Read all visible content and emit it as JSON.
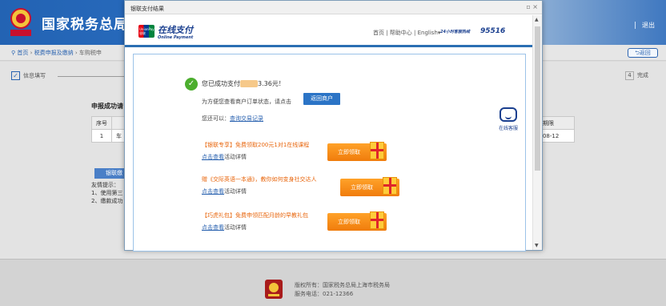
{
  "header": {
    "title": "国家税务总局上",
    "logout": "退出"
  },
  "nav": {
    "home": "首页",
    "crumb2": "税费申报及缴纳",
    "crumb3": "车购税申",
    "back": "返回"
  },
  "steps": {
    "first": "信息填写",
    "last_num": "4",
    "last": "完成"
  },
  "page": {
    "subtitle": "申报成功请",
    "table_left": {
      "headers": [
        "序号",
        ""
      ],
      "row": [
        "1",
        "车"
      ]
    },
    "table_right": {
      "header": "款期限",
      "value": "9-08-12"
    },
    "pay_button": "银联缴",
    "tips": [
      "友情提示：",
      "1、使用第三",
      "2、缴款成功"
    ]
  },
  "footer": {
    "copyright": "版权所有：国家税务总局上海市税务局",
    "phone": "服务电话：021-12366"
  },
  "modal": {
    "title": "银联支付结果",
    "controls": "▫ ×",
    "brand_cn": "在线支付",
    "brand_en": "Online Payment",
    "logo_text": "UnionPay 银联",
    "links": "首页 | 帮助中心 | English▾",
    "hotline_label": "24小时客服热线",
    "hotline": "95516",
    "success_prefix": "您已成功支付",
    "success_amount": "3.36元！",
    "hint": "为方便您查看商户订单状态，请点击",
    "return_button": "返回商户",
    "also": "您还可以：",
    "query_link": "查询交易记录",
    "service": "在线客服",
    "promos": [
      {
        "title": "【银联专享】免费领取200元1对1在线课程",
        "link": "点击查看",
        "rest": "活动详情",
        "button": "立即领取"
      },
      {
        "title": "赠《交际英语一本通》，教你如何变身社交达人",
        "link": "点击查看",
        "rest": "活动详情",
        "button": "立即领取"
      },
      {
        "title": "【巧虎礼包】免费申领匹配月龄的早教礼包",
        "link": "点击查看",
        "rest": "活动详情",
        "button": "立即领取"
      }
    ]
  }
}
